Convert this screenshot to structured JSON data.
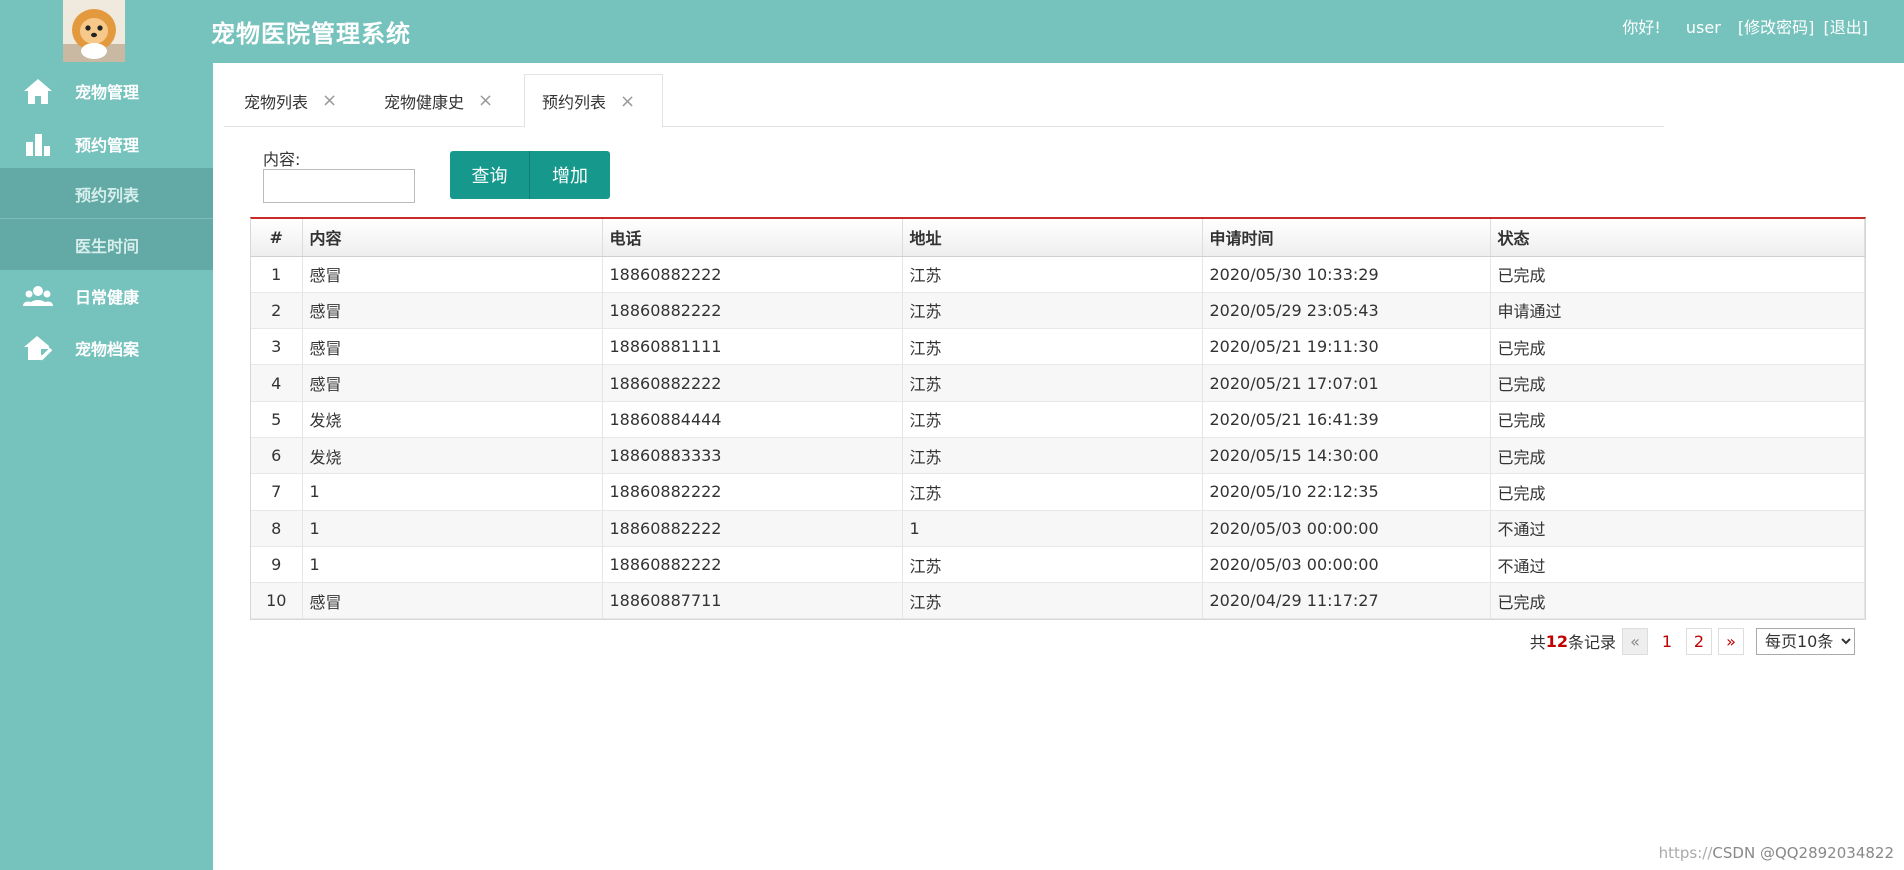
{
  "header": {
    "title": "宠物医院管理系统",
    "greeting": "你好!",
    "username": "user",
    "change_password": "[修改密码]",
    "logout": "[退出]"
  },
  "sidebar": {
    "items": [
      {
        "label": "宠物管理",
        "icon": "home-icon"
      },
      {
        "label": "预约管理",
        "icon": "bar-chart-icon"
      },
      {
        "label": "日常健康",
        "icon": "users-icon"
      },
      {
        "label": "宠物档案",
        "icon": "house-check-icon"
      }
    ],
    "subitems": [
      {
        "label": "预约列表"
      },
      {
        "label": "医生时间"
      }
    ]
  },
  "tabs": [
    {
      "label": "宠物列表"
    },
    {
      "label": "宠物健康史"
    },
    {
      "label": "预约列表",
      "active": true
    }
  ],
  "search": {
    "label": "内容:",
    "value": "",
    "query_label": "查询",
    "add_label": "增加"
  },
  "table": {
    "columns": [
      "#",
      "内容",
      "电话",
      "地址",
      "申请时间",
      "状态"
    ],
    "rows": [
      [
        "1",
        "感冒",
        "18860882222",
        "江苏",
        "2020/05/30 10:33:29",
        "已完成"
      ],
      [
        "2",
        "感冒",
        "18860882222",
        "江苏",
        "2020/05/29 23:05:43",
        "申请通过"
      ],
      [
        "3",
        "感冒",
        "18860881111",
        "江苏",
        "2020/05/21 19:11:30",
        "已完成"
      ],
      [
        "4",
        "感冒",
        "18860882222",
        "江苏",
        "2020/05/21 17:07:01",
        "已完成"
      ],
      [
        "5",
        "发烧",
        "18860884444",
        "江苏",
        "2020/05/21 16:41:39",
        "已完成"
      ],
      [
        "6",
        "发烧",
        "18860883333",
        "江苏",
        "2020/05/15 14:30:00",
        "已完成"
      ],
      [
        "7",
        "1",
        "18860882222",
        "江苏",
        "2020/05/10 22:12:35",
        "已完成"
      ],
      [
        "8",
        "1",
        "18860882222",
        "1",
        "2020/05/03 00:00:00",
        "不通过"
      ],
      [
        "9",
        "1",
        "18860882222",
        "江苏",
        "2020/05/03 00:00:00",
        "不通过"
      ],
      [
        "10",
        "感冒",
        "18860887711",
        "江苏",
        "2020/04/29 11:17:27",
        "已完成"
      ]
    ]
  },
  "pager": {
    "total_prefix": "共",
    "total": "12",
    "total_suffix": "条记录",
    "prev": "«",
    "pages": [
      "1",
      "2"
    ],
    "next": "»",
    "page_size": "每页10条"
  },
  "watermark": {
    "faint": "https://",
    "text": "CSDN @QQ2892034822"
  },
  "colors": {
    "theme": "#76c2bd",
    "sidebar_active": "#63aaa6",
    "button": "#16998c",
    "table_accent": "#c82a2a"
  }
}
